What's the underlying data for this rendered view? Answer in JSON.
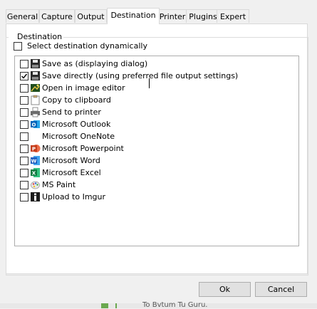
{
  "tabs": [
    {
      "label": "General",
      "active": false
    },
    {
      "label": "Capture",
      "active": false
    },
    {
      "label": "Output",
      "active": false
    },
    {
      "label": "Destination",
      "active": true
    },
    {
      "label": "Printer",
      "active": false
    },
    {
      "label": "Plugins",
      "active": false
    },
    {
      "label": "Expert",
      "active": false
    }
  ],
  "group": {
    "title": "Destination",
    "dynamic_label": "Select destination dynamically",
    "dynamic_checked": false
  },
  "destinations": [
    {
      "label": "Save as (displaying dialog)",
      "checked": false,
      "icon": "floppy-disk-icon"
    },
    {
      "label": "Save directly (using preferred file output settings)",
      "checked": true,
      "icon": "floppy-disk-icon"
    },
    {
      "label": "Open in image editor",
      "checked": false,
      "icon": "image-editor-icon"
    },
    {
      "label": "Copy to clipboard",
      "checked": false,
      "icon": "clipboard-icon"
    },
    {
      "label": "Send to printer",
      "checked": false,
      "icon": "printer-icon"
    },
    {
      "label": "Microsoft Outlook",
      "checked": false,
      "icon": "outlook-icon"
    },
    {
      "label": "Microsoft OneNote",
      "checked": false,
      "icon": "none"
    },
    {
      "label": "Microsoft Powerpoint",
      "checked": false,
      "icon": "powerpoint-icon"
    },
    {
      "label": "Microsoft Word",
      "checked": false,
      "icon": "word-icon"
    },
    {
      "label": "Microsoft Excel",
      "checked": false,
      "icon": "excel-icon"
    },
    {
      "label": "MS Paint",
      "checked": false,
      "icon": "paint-palette-icon"
    },
    {
      "label": "Upload to Imgur",
      "checked": false,
      "icon": "imgur-icon"
    }
  ],
  "buttons": {
    "ok": "Ok",
    "cancel": "Cancel"
  },
  "background_text": "To Bvtum Tu Guru."
}
